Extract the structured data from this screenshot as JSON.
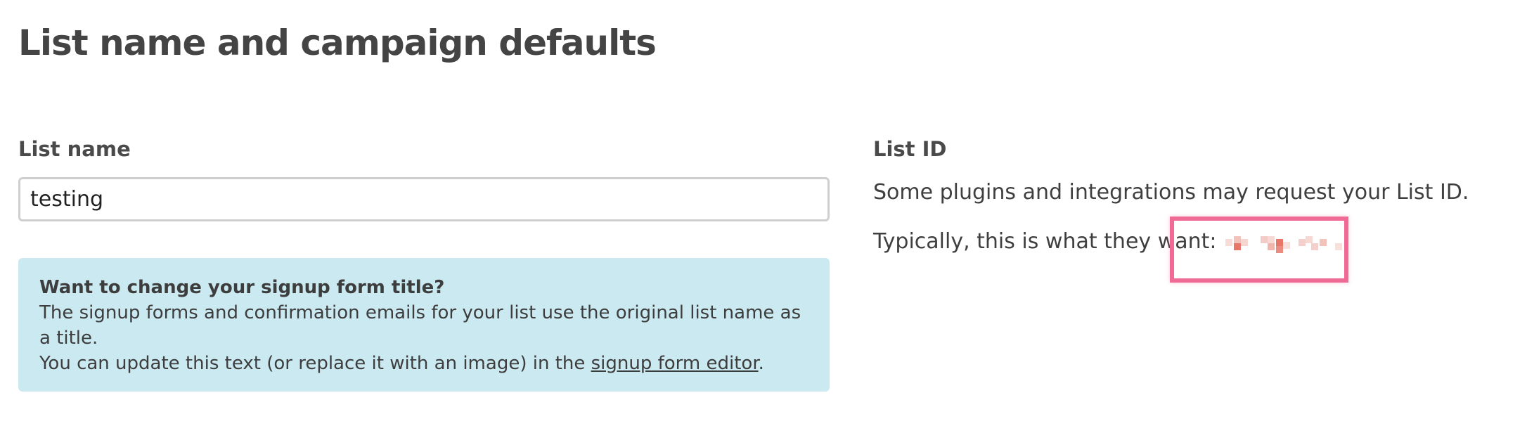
{
  "page": {
    "title": "List name and campaign defaults"
  },
  "list_name": {
    "label": "List name",
    "value": "testing"
  },
  "info_box": {
    "heading": "Want to change your signup form title?",
    "line1": "The signup forms and confirmation emails for your list use the original list name as a title.",
    "line2_prefix": "You can update this text (or replace it with an image) in the ",
    "link_text": "signup form editor",
    "line2_suffix": "."
  },
  "list_id": {
    "label": "List ID",
    "description": "Some plugins and integrations may request your List ID.",
    "typical_prefix": "Typically, this is what they want:",
    "value_redacted": true
  },
  "colors": {
    "info_background": "#cbe9f1",
    "highlight_border": "#f06a96",
    "redaction_red": "#e8776a",
    "redaction_pink": "#f4cfcb"
  }
}
